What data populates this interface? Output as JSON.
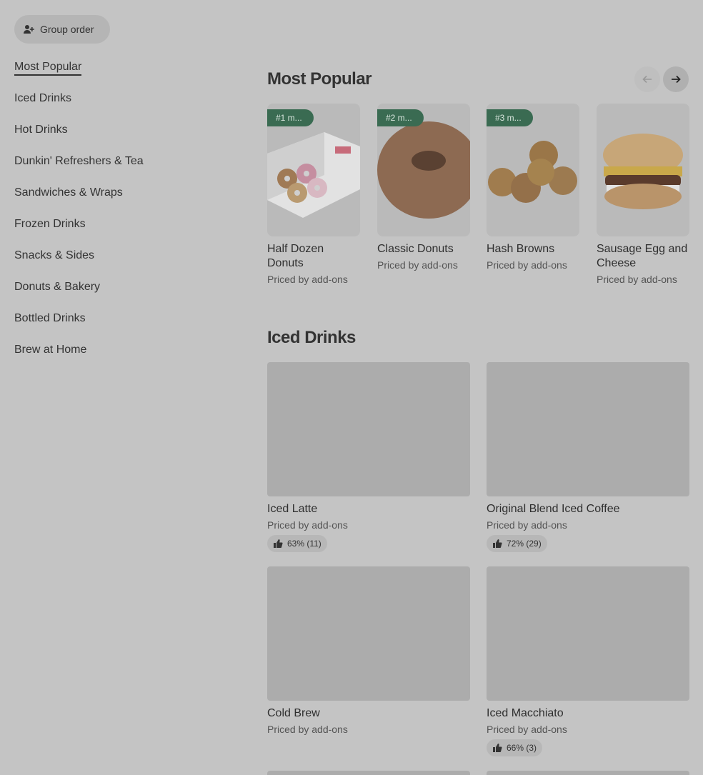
{
  "group_order": {
    "label": "Group order",
    "icon": "add-person-icon"
  },
  "sidebar": {
    "items": [
      {
        "label": "Most Popular"
      },
      {
        "label": "Iced Drinks"
      },
      {
        "label": "Hot Drinks"
      },
      {
        "label": "Dunkin' Refreshers & Tea"
      },
      {
        "label": "Sandwiches & Wraps"
      },
      {
        "label": "Frozen Drinks"
      },
      {
        "label": "Snacks & Sides"
      },
      {
        "label": "Donuts & Bakery"
      },
      {
        "label": "Bottled Drinks"
      },
      {
        "label": "Brew at Home"
      }
    ]
  },
  "most_popular": {
    "title": "Most Popular",
    "cards": [
      {
        "badge": "#1 m...",
        "name": "Half Dozen Donuts",
        "price": "Priced by add-ons"
      },
      {
        "badge": "#2 m...",
        "name": "Classic Donuts",
        "price": "Priced by add-ons"
      },
      {
        "badge": "#3 m...",
        "name": "Hash Browns",
        "price": "Priced by add-ons"
      },
      {
        "badge": "",
        "name": "Sausage Egg and Cheese",
        "price": "Priced by add-ons"
      }
    ]
  },
  "iced_drinks": {
    "title": "Iced Drinks",
    "cards": [
      {
        "name": "Iced Latte",
        "price": "Priced by add-ons",
        "rating": "63% (11)"
      },
      {
        "name": "Original Blend Iced Coffee",
        "price": "Priced by add-ons",
        "rating": "72% (29)"
      },
      {
        "name": "Cold Brew",
        "price": "Priced by add-ons",
        "rating": ""
      },
      {
        "name": "Iced Macchiato",
        "price": "Priced by add-ons",
        "rating": "66% (3)"
      }
    ]
  },
  "colors": {
    "overlay_bg": "#c4c4c4",
    "badge_green": "#3a6b52",
    "text": "#2e2e2e"
  }
}
